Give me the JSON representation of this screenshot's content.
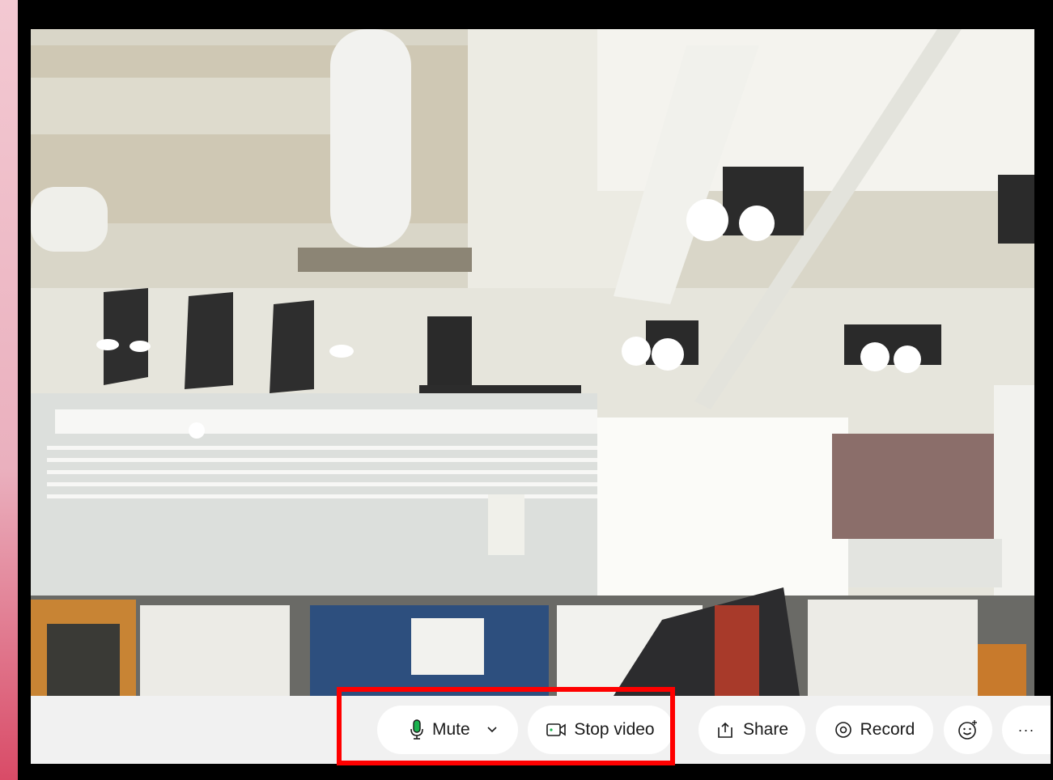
{
  "toolbar": {
    "mute_label": "Mute",
    "stop_video_label": "Stop video",
    "share_label": "Share",
    "record_label": "Record",
    "more_label": "···"
  },
  "icons": {
    "mute": "microphone-icon",
    "audio_options": "chevron-down-icon",
    "video": "video-camera-icon",
    "share": "share-icon",
    "record": "record-icon",
    "reactions": "emoji-icon",
    "more": "more-icon"
  },
  "colors": {
    "mic_active": "#1ab24e",
    "highlight": "#ff0000",
    "toolbar_bg": "#f1f1f1"
  }
}
